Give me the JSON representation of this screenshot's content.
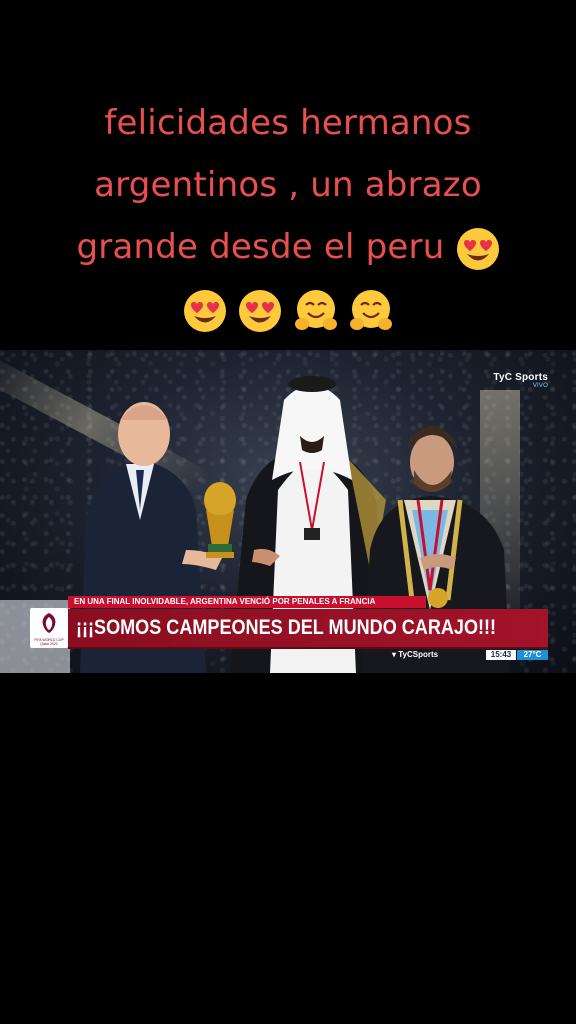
{
  "caption": {
    "line1": "felicidades hermanos",
    "line2": "argentinos , un abrazo",
    "line3": "grande desde el peru",
    "emojis_line3": [
      "heart-eyes-emoji"
    ],
    "emojis_line4": [
      "heart-eyes-emoji",
      "heart-eyes-emoji",
      "hugging-emoji",
      "hugging-emoji"
    ]
  },
  "video": {
    "broadcaster_logo": "TyC Sports",
    "broadcaster_sub": "VIVO",
    "subheadline": "EN UNA FINAL INOLVIDABLE, ARGENTINA VENCIÓ POR PENALES A FRANCIA",
    "headline": "¡¡¡SOMOS CAMPEONES DEL MUNDO CARAJO!!!",
    "badge_text": "FIFA WORLD CUP Qatar 2022",
    "ticker_brand": "TyCSports",
    "time": "15:43",
    "temperature": "27°C"
  },
  "colors": {
    "caption_text": "#e8504f",
    "headline_bar": "#a3132a",
    "subheadline_strip": "#c8102e",
    "temp_badge": "#1e90d6"
  }
}
